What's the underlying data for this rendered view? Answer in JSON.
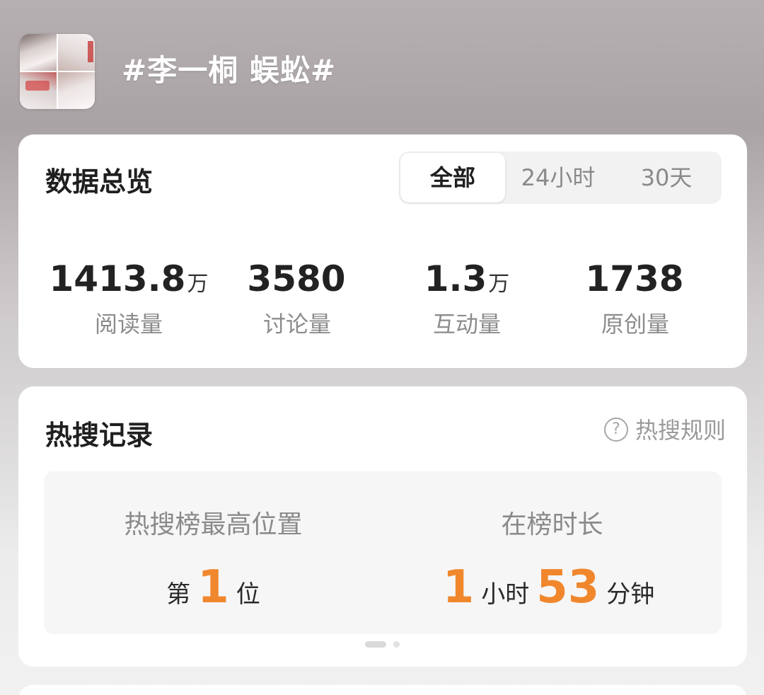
{
  "topic": {
    "title": "#李一桐 蜈蚣#"
  },
  "overview": {
    "title": "数据总览",
    "tabs": [
      "全部",
      "24小时",
      "30天"
    ],
    "selected_tab": "全部",
    "stats": [
      {
        "value": "1413.8",
        "unit": "万",
        "label": "阅读量"
      },
      {
        "value": "3580",
        "unit": "",
        "label": "讨论量"
      },
      {
        "value": "1.3",
        "unit": "万",
        "label": "互动量"
      },
      {
        "value": "1738",
        "unit": "",
        "label": "原创量"
      }
    ]
  },
  "hot_search": {
    "title": "热搜记录",
    "rules_label": "热搜规则",
    "rules_icon": "?",
    "highest_position": {
      "label": "热搜榜最高位置",
      "prefix": "第",
      "value": "1",
      "suffix": "位"
    },
    "duration": {
      "label": "在榜时长",
      "hours": "1",
      "hours_unit": "小时",
      "minutes": "53",
      "minutes_unit": "分钟"
    },
    "pager": {
      "pages": 2,
      "current": 1
    }
  },
  "colors": {
    "accent": "#f0872d",
    "text_primary": "#1f1f1f",
    "text_secondary": "#8c8c8c"
  }
}
